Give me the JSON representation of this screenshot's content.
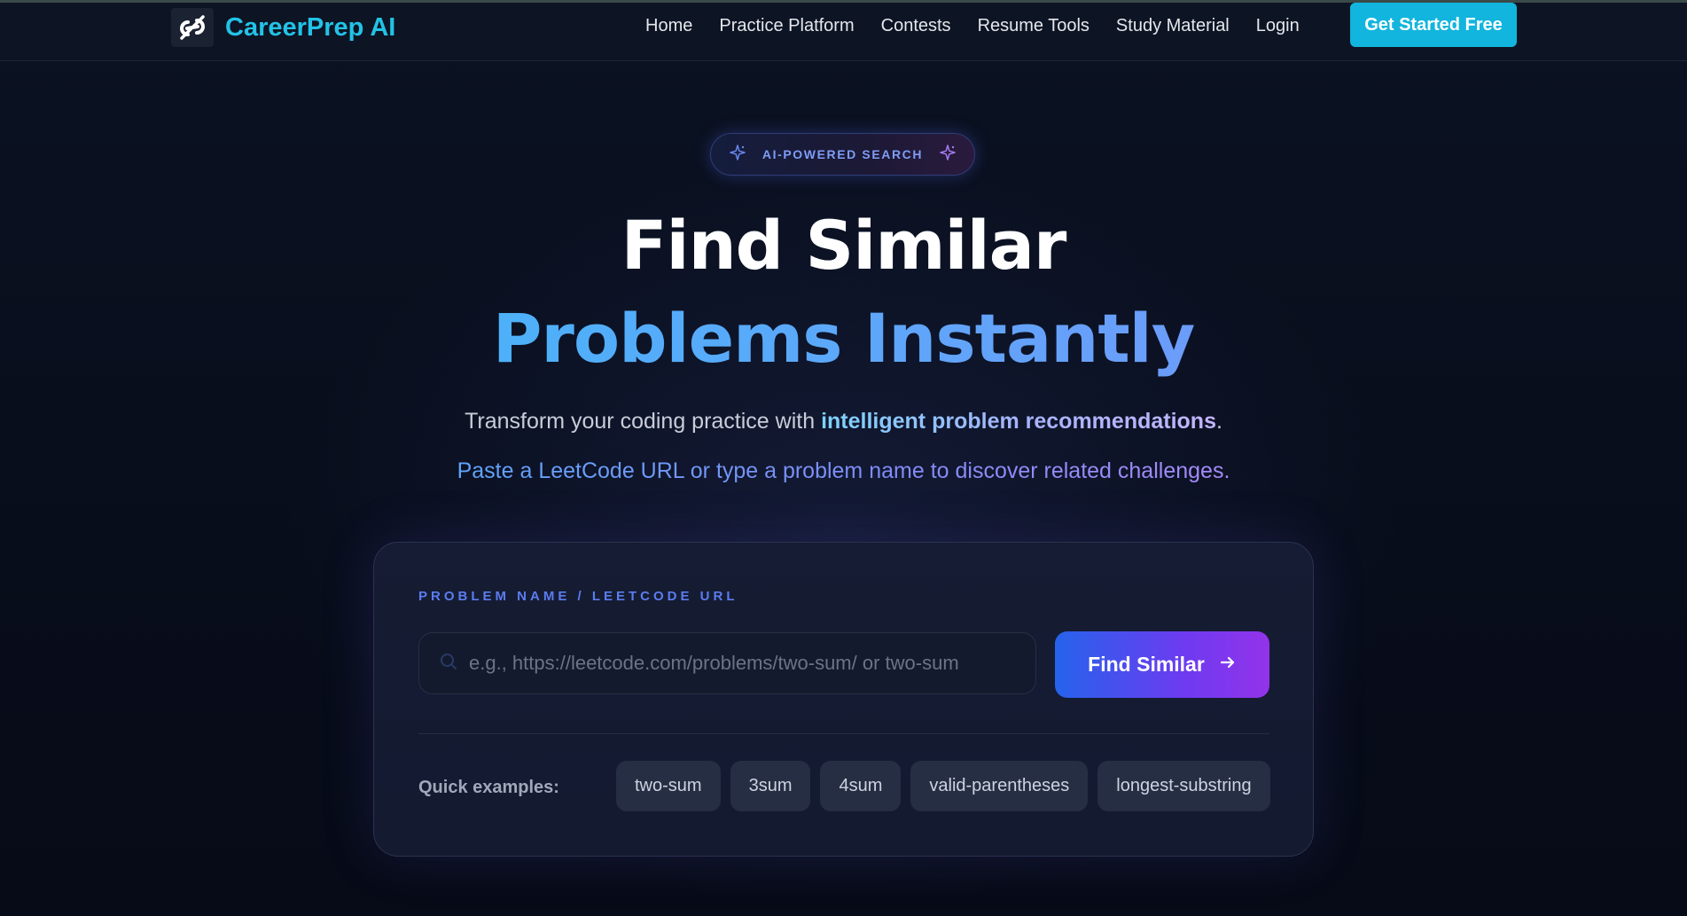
{
  "brand": {
    "name": "CareerPrep AI",
    "logo_icon": "no-link-icon"
  },
  "nav": {
    "links": [
      "Home",
      "Practice Platform",
      "Contests",
      "Resume Tools",
      "Study Material",
      "Login"
    ],
    "cta": "Get Started Free"
  },
  "badge": {
    "label": "AI-POWERED SEARCH",
    "icon": "sparkle-icon"
  },
  "hero": {
    "line1": "Find Similar",
    "line2": "Problems Instantly",
    "sub_prefix": "Transform your coding practice with ",
    "sub_highlight": "intelligent problem recommendations",
    "sub_suffix": ".",
    "sub2": "Paste a LeetCode URL or type a problem name to discover related challenges."
  },
  "search": {
    "label": "PROBLEM NAME / LEETCODE URL",
    "placeholder": "e.g., https://leetcode.com/problems/two-sum/ or two-sum",
    "value": "",
    "button": "Find Similar"
  },
  "examples": {
    "label": "Quick examples:",
    "items": [
      "two-sum",
      "3sum",
      "4sum",
      "valid-parentheses",
      "longest-substring"
    ]
  },
  "colors": {
    "background": "#090e1c",
    "brand": "#22c3e6",
    "cta": "#12b5dd",
    "accent_blue": "#2563eb",
    "accent_purple": "#9333ea"
  }
}
